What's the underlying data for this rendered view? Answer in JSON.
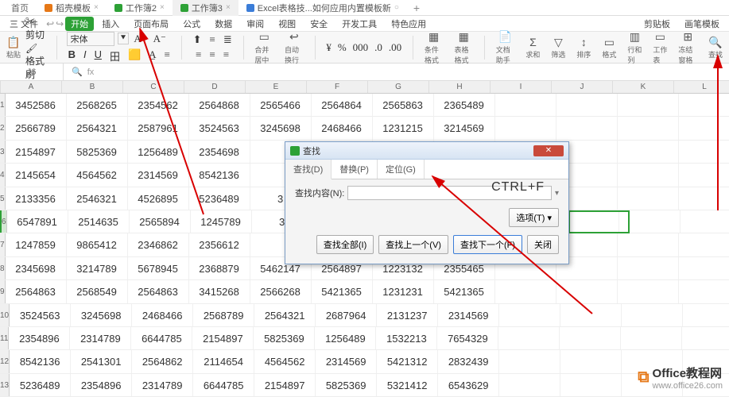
{
  "tabs": [
    {
      "icon_color": "#e67817",
      "label": "稻壳模板",
      "closable": true,
      "active": false
    },
    {
      "icon_color": "#2da136",
      "label": "工作簿2",
      "closable": true,
      "active": false
    },
    {
      "icon_color": "#2da136",
      "label": "工作簿3",
      "closable": true,
      "active": true
    },
    {
      "icon_color": "#3b7dd8",
      "label": "Excel表格技...如何应用内置模板新",
      "closable": true,
      "active": false
    }
  ],
  "home_tab": "首页",
  "add_tab": "+",
  "menu": {
    "file": "三 文件",
    "start": "开始",
    "insert": "插入",
    "layout": "页面布局",
    "formula": "公式",
    "data": "数据",
    "review": "审阅",
    "view": "视图",
    "security": "安全",
    "dev": "开发工具",
    "special": "特色应用",
    "clip": "剪贴板",
    "brush": "画笔模板"
  },
  "toolbar": {
    "paste": "粘贴",
    "cut": "剪切",
    "format_painter": "格式刷",
    "font": "宋体",
    "center": "合并居中",
    "wrap": "自动换行",
    "cond": "条件格式",
    "tbl": "表格格式",
    "doc": "文档助手",
    "sum": "求和",
    "filter": "筛选",
    "sort": "排序",
    "fmt2": "格式",
    "cols": "行和列",
    "ws": "工作表",
    "freeze": "冻结窗格",
    "find": "查找"
  },
  "formula": {
    "cell_ref": "J6",
    "fx": "fx"
  },
  "columns": [
    "A",
    "B",
    "C",
    "D",
    "E",
    "F",
    "G",
    "H",
    "I",
    "J",
    "K",
    "L"
  ],
  "rows": [
    {
      "n": 1,
      "c": [
        "3452586",
        "2568265",
        "2354562",
        "2564868",
        "2565466",
        "2564864",
        "2565863",
        "2365489",
        "",
        "",
        "",
        ""
      ]
    },
    {
      "n": 2,
      "c": [
        "2566789",
        "2564321",
        "2587961",
        "3524563",
        "3245698",
        "2468466",
        "1231215",
        "3214569",
        "",
        "",
        "",
        ""
      ]
    },
    {
      "n": 3,
      "c": [
        "2154897",
        "5825369",
        "1256489",
        "2354698",
        "",
        "",
        "",
        "",
        "",
        "",
        "",
        ""
      ]
    },
    {
      "n": 4,
      "c": [
        "2145654",
        "4564562",
        "2314569",
        "8542136",
        "",
        "",
        "",
        "",
        "",
        "",
        "",
        ""
      ]
    },
    {
      "n": 5,
      "c": [
        "2133356",
        "2546321",
        "4526895",
        "5236489",
        "3",
        "",
        "",
        "",
        "",
        "",
        "",
        ""
      ]
    },
    {
      "n": 6,
      "c": [
        "6547891",
        "2514635",
        "2565894",
        "1245789",
        "3",
        "",
        "",
        "",
        "",
        "",
        "",
        ""
      ]
    },
    {
      "n": 7,
      "c": [
        "1247859",
        "9865412",
        "2346862",
        "2356612",
        "",
        "",
        "",
        "",
        "",
        "",
        "",
        ""
      ]
    },
    {
      "n": 8,
      "c": [
        "2345698",
        "3214789",
        "5678945",
        "2368879",
        "5462147",
        "2564897",
        "1223132",
        "2355465",
        "",
        "",
        "",
        ""
      ]
    },
    {
      "n": 9,
      "c": [
        "2564863",
        "2568549",
        "2564863",
        "3415268",
        "2566268",
        "5421365",
        "1231231",
        "5421365",
        "",
        "",
        "",
        ""
      ]
    },
    {
      "n": 10,
      "c": [
        "3524563",
        "3245698",
        "2468466",
        "2568789",
        "2564321",
        "2687964",
        "2131237",
        "2314569",
        "",
        "",
        "",
        ""
      ]
    },
    {
      "n": 11,
      "c": [
        "2354896",
        "2314789",
        "6644785",
        "2154897",
        "5825369",
        "1256489",
        "1532213",
        "7654329",
        "",
        "",
        "",
        ""
      ]
    },
    {
      "n": 12,
      "c": [
        "8542136",
        "2541301",
        "2564862",
        "2114654",
        "4564562",
        "2314569",
        "5421312",
        "2832439",
        "",
        "",
        "",
        ""
      ]
    },
    {
      "n": 13,
      "c": [
        "5236489",
        "2354896",
        "2314789",
        "6644785",
        "2154897",
        "5825369",
        "5321412",
        "6543629",
        "",
        "",
        "",
        ""
      ]
    }
  ],
  "dialog": {
    "title": "查找",
    "tabs": [
      "查找(D)",
      "替换(P)",
      "定位(G)"
    ],
    "kbd": "CTRL+F",
    "label": "查找内容(N):",
    "options": "选项(T) ▾",
    "btn_all": "查找全部(I)",
    "btn_prev": "查找上一个(V)",
    "btn_next": "查找下一个(F)",
    "btn_close": "关闭"
  },
  "watermark": {
    "brand": "Office教程网",
    "url": "www.office26.com"
  },
  "icons": {
    "lens": "🔍",
    "back": "↩",
    "fwd": "↪"
  }
}
